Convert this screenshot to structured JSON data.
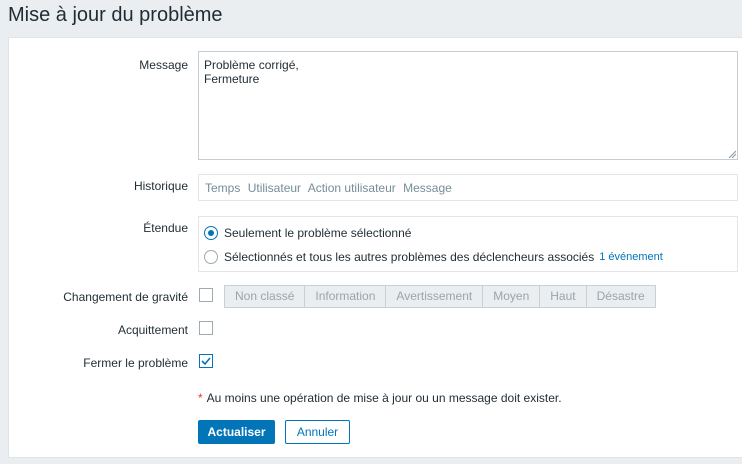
{
  "dialog": {
    "title": "Mise à jour du problème"
  },
  "form": {
    "message_label": "Message",
    "message_value": "Problème corrigé,\nFermeture",
    "history_label": "Historique",
    "history_columns": [
      "Temps",
      "Utilisateur",
      "Action utilisateur",
      "Message"
    ],
    "scope_label": "Étendue",
    "scope_options": [
      {
        "label": "Seulement le problème sélectionné",
        "selected": true
      },
      {
        "label": "Sélectionnés et tous les autres problèmes des déclencheurs associés",
        "selected": false,
        "extra": "1 événement"
      }
    ],
    "severity_change_label": "Changement de gravité",
    "severity_change_checked": false,
    "severities": [
      "Non classé",
      "Information",
      "Avertissement",
      "Moyen",
      "Haut",
      "Désastre"
    ],
    "ack_label": "Acquittement",
    "ack_checked": false,
    "close_label": "Fermer le problème",
    "close_checked": true,
    "required_note": "Au moins une opération de mise à jour ou un message doit exister.",
    "required_marker": "*"
  },
  "buttons": {
    "update": "Actualiser",
    "cancel": "Annuler"
  },
  "colors": {
    "accent": "#0275b8",
    "required": "#e33734",
    "background": "#ebeef0"
  }
}
